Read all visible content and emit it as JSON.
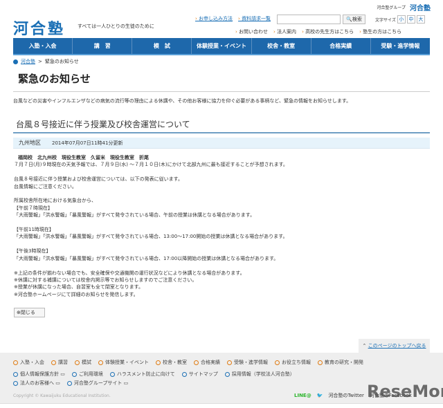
{
  "group": {
    "label": "河合塾グループ",
    "logo": "河合塾"
  },
  "logo": "河合塾",
  "tagline": "すべては一人ひとりの生徒のために",
  "links1": [
    "お申し込み方法",
    "資料請求一覧"
  ],
  "search": {
    "placeholder": "",
    "button": "検索"
  },
  "font_size": {
    "label": "文字サイズ",
    "options": [
      "小",
      "中",
      "大"
    ]
  },
  "links2": [
    "お問い合わせ",
    "法人案内",
    "高校の先生方はこちら",
    "塾生の方はこちら"
  ],
  "nav": [
    "入塾・入会",
    "講　習",
    "模　試",
    "体験授業・イベント",
    "校舎・教室",
    "合格実績",
    "受験・進学情報"
  ],
  "breadcrumb": [
    "河合塾",
    ">",
    "緊急のお知らせ"
  ],
  "title": "緊急のお知らせ",
  "intro": "台風などの災害やインフルエンザなどの病気の流行等の理由による休講や、その他お客様に協力を仰ぐ必要がある事柄など、緊急の情報をお知らせします。",
  "section_title": "台風８号接近に伴う授業及び校舎運営について",
  "region": {
    "name": "九州地区",
    "updated": "2014年07月07日11時41分更新"
  },
  "body": {
    "schools": "福岡校　北九州校　現役生教室　久留米　現役生教室　折尾",
    "lines": [
      "７月７日(月)９時現在の天気予報では、７月９日(水) ～７月１０日(木)にかけて北部九州に最も接近することが予想されます。",
      "",
      "台風８号接近に伴う授業および校舎運営については、以下の発表に従います。",
      "台風情報にご注意ください。",
      "",
      "所属校舎所在地における気象台から、",
      "【午前７時現在】",
      "「大雨警報」「洪水警報」「暴風警報」がすべて発令されている場合、午前の授業は休講となる場合があります。",
      "",
      "【午前11時現在】",
      "「大雨警報」「洪水警報」「暴風警報」がすべて発令されている場合、13:00～17:00開始の授業は休講となる場合があります。",
      "",
      "【午後3時現在】",
      "「大雨警報」「洪水警報」「暴風警報」がすべて発令されている場合、17:00以降開始の授業は休講となる場合があります。",
      "",
      "※上記の条件が揃わない場合でも、安全確保や交通機関の運行状況などにより休講となる場合があります。",
      "※休講に対する補講については校舎内掲示等でお知らせしますのでご注意ください。",
      "※授業が休講になった場合、自習室も全て閉室となります。",
      "※河合塾ホームページにて詳細のお知らせを発信します。"
    ]
  },
  "close": "⊕閉じる",
  "page_top": "このページのトップへ戻る",
  "footer": {
    "row1": [
      "入塾・入会",
      "講習",
      "模試",
      "体験授業・イベント",
      "校舎・教室",
      "合格実績",
      "受験・進学情報",
      "お役立ち情報",
      "教育の研究・開発"
    ],
    "row2": [
      "個人情報保護方針 ▭",
      "ご利用環境",
      "ハラスメント防止に向けて",
      "サイトマップ",
      "採用情報（学校法人河合塾）"
    ],
    "row3": [
      "法人のお客様へ ▭",
      "河合塾グループサイト ▭"
    ],
    "copyright": "Copyright © Kawaijuku Educational Institution.",
    "social": [
      "LINE@",
      "河合塾のTwitter",
      "河合塾のFacebook"
    ]
  },
  "watermark": "ReseMom"
}
